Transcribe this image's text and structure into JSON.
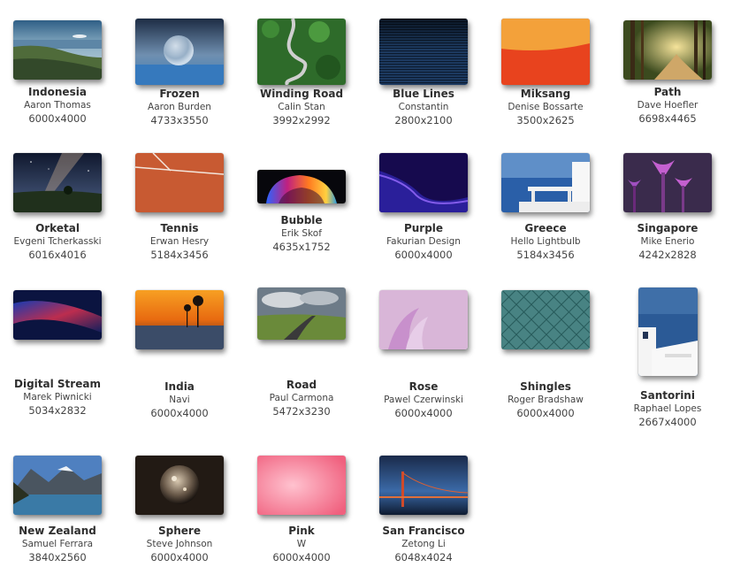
{
  "wallpapers": [
    {
      "title": "Indonesia",
      "author": "Aaron Thomas",
      "resolution": "6000x4000",
      "icon": "indonesia-landscape-thumbnail"
    },
    {
      "title": "Frozen",
      "author": "Aaron Burden",
      "resolution": "4733x3550",
      "icon": "frozen-bubble-thumbnail"
    },
    {
      "title": "Winding Road",
      "author": "Calin Stan",
      "resolution": "3992x2992",
      "icon": "winding-road-thumbnail"
    },
    {
      "title": "Blue Lines",
      "author": "Constantin",
      "resolution": "2800x2100",
      "icon": "blue-lines-thumbnail"
    },
    {
      "title": "Miksang",
      "author": "Denise Bossarte",
      "resolution": "3500x2625",
      "icon": "miksang-thumbnail"
    },
    {
      "title": "Path",
      "author": "Dave Hoefler",
      "resolution": "6698x4465",
      "icon": "forest-path-thumbnail"
    },
    {
      "title": "Orketal",
      "author": "Evgeni Tcherkasski",
      "resolution": "6016x4016",
      "icon": "milky-way-thumbnail"
    },
    {
      "title": "Tennis",
      "author": "Erwan Hesry",
      "resolution": "5184x3456",
      "icon": "tennis-court-thumbnail"
    },
    {
      "title": "Bubble",
      "author": "Erik Skof",
      "resolution": "4635x1752",
      "icon": "bubble-thumbnail"
    },
    {
      "title": "Purple",
      "author": "Fakurian Design",
      "resolution": "6000x4000",
      "icon": "purple-wave-thumbnail"
    },
    {
      "title": "Greece",
      "author": "Hello Lightbulb",
      "resolution": "5184x3456",
      "icon": "greece-terrace-thumbnail"
    },
    {
      "title": "Singapore",
      "author": "Mike Enerio",
      "resolution": "4242x2828",
      "icon": "supertree-thumbnail"
    },
    {
      "title": "Digital Stream",
      "author": "Marek Piwnicki",
      "resolution": "5034x2832",
      "icon": "digital-stream-thumbnail"
    },
    {
      "title": "India",
      "author": "Navi",
      "resolution": "6000x4000",
      "icon": "palm-sunset-thumbnail"
    },
    {
      "title": "Road",
      "author": "Paul Carmona",
      "resolution": "5472x3230",
      "icon": "road-clouds-thumbnail"
    },
    {
      "title": "Rose",
      "author": "Pawel Czerwinski",
      "resolution": "6000x4000",
      "icon": "rose-waves-thumbnail"
    },
    {
      "title": "Shingles",
      "author": "Roger Bradshaw",
      "resolution": "6000x4000",
      "icon": "shingles-thumbnail"
    },
    {
      "title": "Santorini",
      "author": "Raphael Lopes",
      "resolution": "2667x4000",
      "icon": "santorini-thumbnail"
    },
    {
      "title": "New Zealand",
      "author": "Samuel Ferrara",
      "resolution": "3840x2560",
      "icon": "mountain-lake-thumbnail"
    },
    {
      "title": "Sphere",
      "author": "Steve Johnson",
      "resolution": "6000x4000",
      "icon": "glass-sphere-thumbnail"
    },
    {
      "title": "Pink",
      "author": "W",
      "resolution": "6000x4000",
      "icon": "pink-gradient-thumbnail"
    },
    {
      "title": "San Francisco",
      "author": "Zetong Li",
      "resolution": "6048x4024",
      "icon": "golden-gate-thumbnail"
    }
  ]
}
